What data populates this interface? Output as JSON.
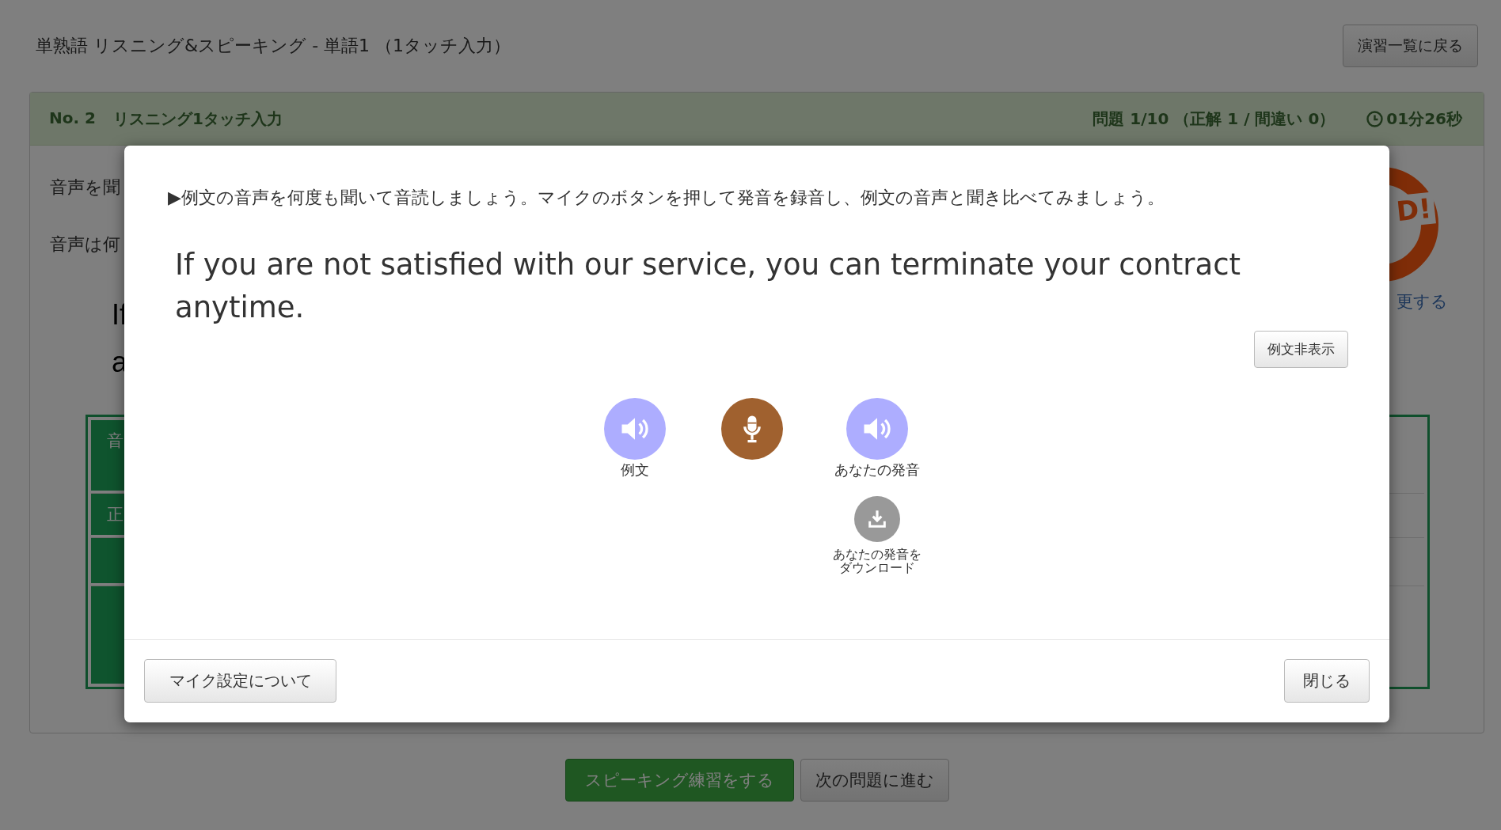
{
  "page": {
    "title": "単熟語 リスニング&スピーキング - 単語1 （1タッチ入力）",
    "back_button": "演習一覧に戻る"
  },
  "panel": {
    "number": "No. 2",
    "title": "リスニング1タッチ入力",
    "progress": "問題 1/10 （正解 1 / 間違い 0）",
    "timer": "01分26秒",
    "body_lines": [
      "音声を聞",
      "音声は何"
    ],
    "sentence_lines": [
      "If",
      "a"
    ],
    "stamp": {
      "text": "D!"
    },
    "stamp_link": "更する",
    "table_rows": [
      {
        "kind": "labeled",
        "label": "音"
      },
      {
        "kind": "labeled",
        "label": "正"
      },
      {
        "kind": "blank"
      },
      {
        "kind": "blank"
      }
    ]
  },
  "buttons": [
    {
      "kind": "primary",
      "label": "スピーキング練習をする"
    },
    {
      "kind": "default",
      "label": "次の問題に進む"
    }
  ],
  "modal": {
    "instruction": "▶例文の音声を何度も聞いて音読しましょう。マイクのボタンを押して発音を録音し、例文の音声と聞き比べてみましょう。",
    "sentence": "If you are not satisfied with our service, you can terminate your contract anytime.",
    "hide_button": "例文非表示",
    "controls": [
      {
        "kind": "speaker",
        "label": "例文"
      },
      {
        "kind": "mic"
      },
      {
        "kind": "speaker",
        "label": "あなたの発音"
      }
    ],
    "download": {
      "label": "あなたの発音をダウンロード"
    },
    "footer_buttons": [
      "マイク設定について",
      "閉じる"
    ]
  }
}
